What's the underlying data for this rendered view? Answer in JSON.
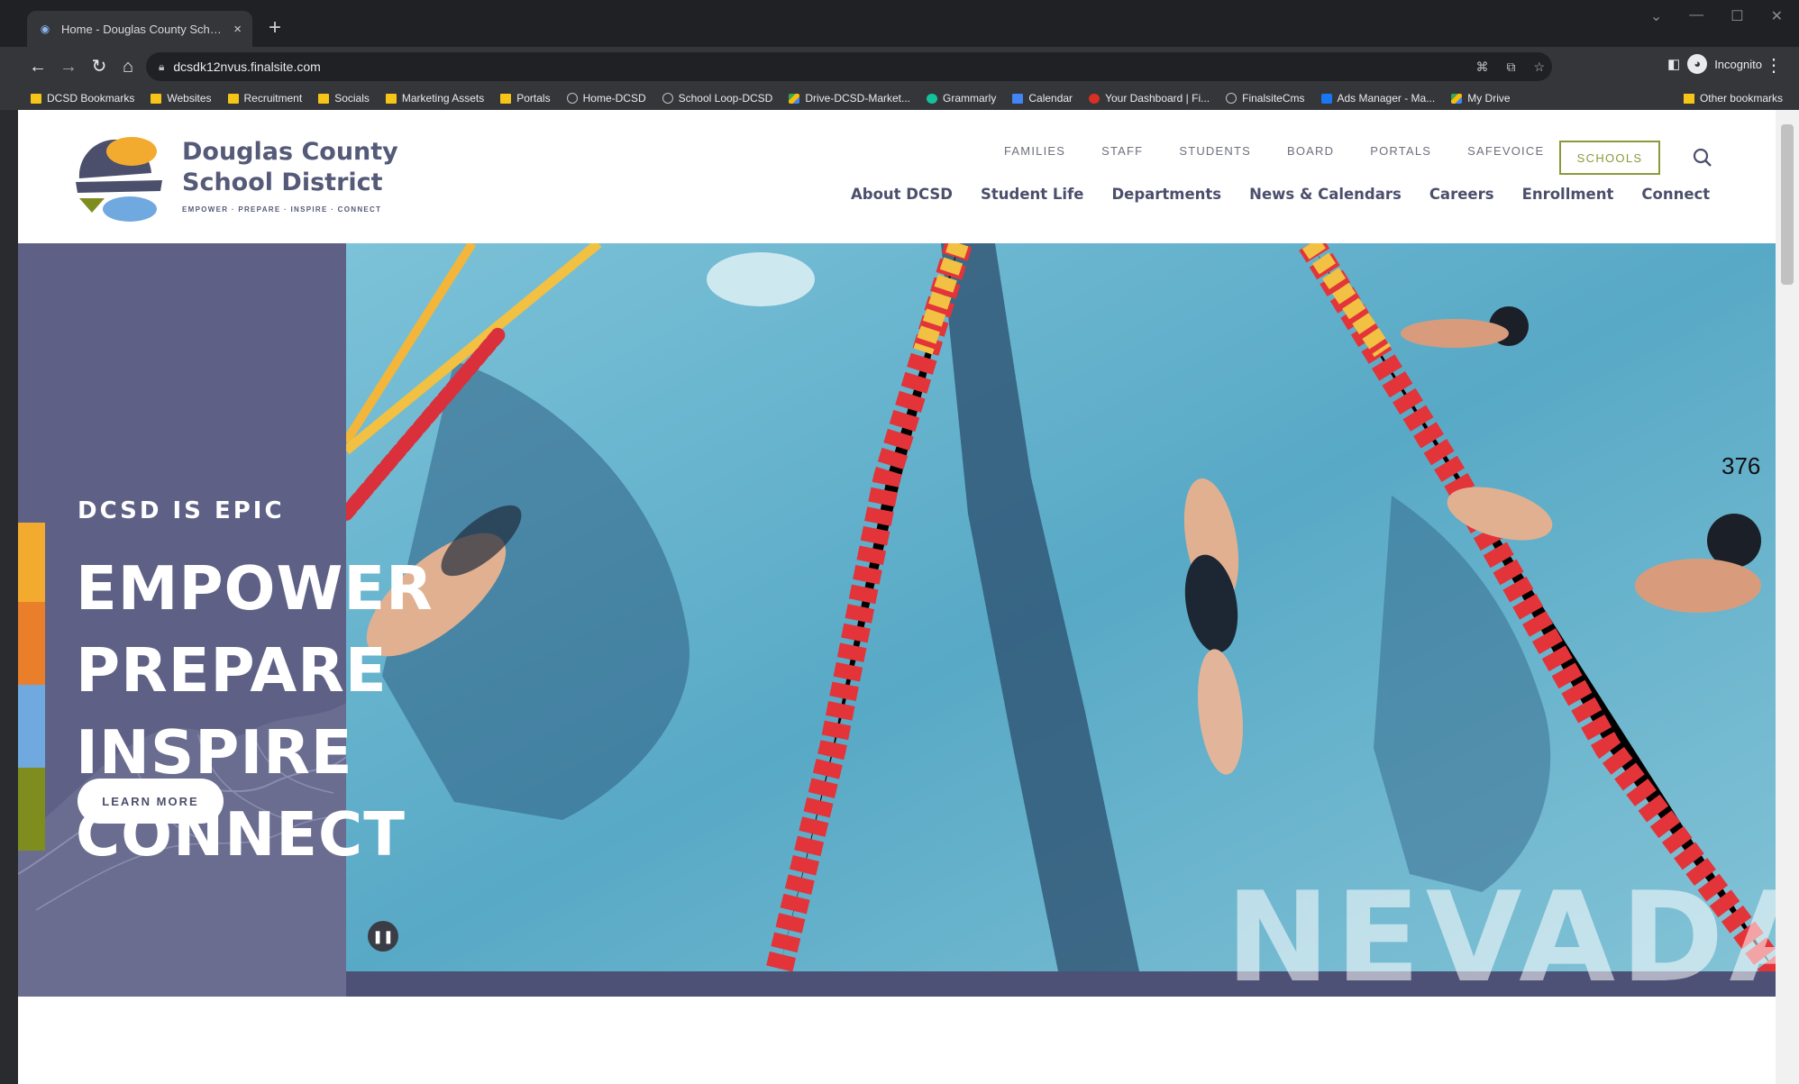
{
  "browser": {
    "tab_title": "Home - Douglas County School",
    "tab_close": "×",
    "new_tab": "+",
    "url": "dcsdk12nvus.finalsite.com",
    "profile": "Incognito",
    "bookmarks": [
      {
        "label": "DCSD Bookmarks",
        "icon": "folder-icon"
      },
      {
        "label": "Websites",
        "icon": "folder-icon"
      },
      {
        "label": "Recruitment",
        "icon": "folder-icon"
      },
      {
        "label": "Socials",
        "icon": "folder-icon"
      },
      {
        "label": "Marketing Assets",
        "icon": "folder-icon"
      },
      {
        "label": "Portals",
        "icon": "folder-icon"
      },
      {
        "label": "Home-DCSD",
        "icon": "globe-icon"
      },
      {
        "label": "School Loop-DCSD",
        "icon": "globe-icon"
      },
      {
        "label": "Drive-DCSD-Market...",
        "icon": "drive-icon"
      },
      {
        "label": "Grammarly",
        "icon": "grammarly-icon"
      },
      {
        "label": "Calendar",
        "icon": "calendar-icon"
      },
      {
        "label": "Your Dashboard | Fi...",
        "icon": "dashboard-icon"
      },
      {
        "label": "FinalsiteCms",
        "icon": "globe-icon"
      },
      {
        "label": "Ads Manager - Ma...",
        "icon": "meta-icon"
      },
      {
        "label": "My Drive",
        "icon": "drive-icon"
      }
    ],
    "other_bookmarks": "Other bookmarks"
  },
  "site": {
    "name_line1": "Douglas County",
    "name_line2": "School District",
    "tagline": "EMPOWER · PREPARE · INSPIRE · CONNECT",
    "utility_nav": [
      "FAMILIES",
      "STAFF",
      "STUDENTS",
      "BOARD",
      "PORTALS",
      "SAFEVOICE"
    ],
    "schools_button": "SCHOOLS",
    "main_nav": [
      "About DCSD",
      "Student Life",
      "Departments",
      "News & Calendars",
      "Careers",
      "Enrollment",
      "Connect"
    ],
    "colors": {
      "brand_purple": "#5e6185",
      "accent_olive": "#8a9a3a",
      "bar_yellow": "#f3ab2f",
      "bar_orange": "#e97f2a",
      "bar_blue": "#6fa9df",
      "bar_green": "#7f8c1e"
    }
  },
  "hero": {
    "kicker": "DCSD IS EPIC",
    "lines": [
      "EMPOWER",
      "PREPARE",
      "INSPIRE",
      "CONNECT"
    ],
    "button": "LEARN MORE",
    "overlay_text": "NEVADA",
    "pause_icon": "pause-icon"
  },
  "overlay_number": "376"
}
